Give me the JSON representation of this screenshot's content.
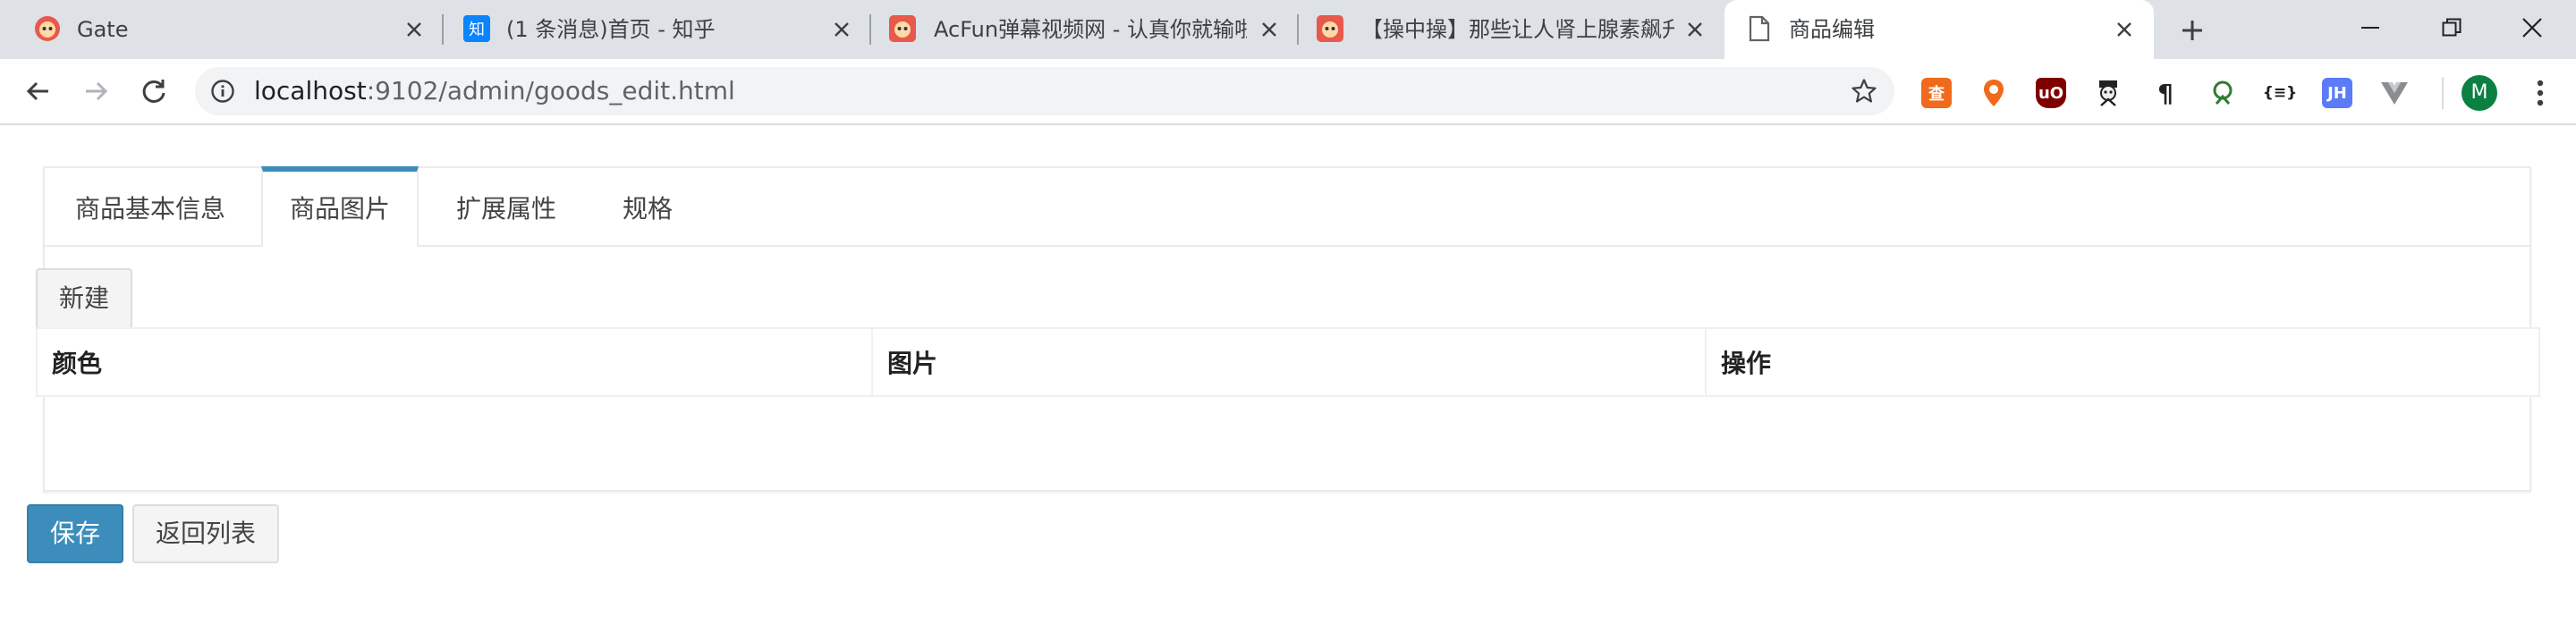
{
  "browser": {
    "tabs": [
      {
        "title": "Gate",
        "active": false
      },
      {
        "title": "(1 条消息)首页 - 知乎",
        "active": false
      },
      {
        "title": "AcFun弹幕视频网 - 认真你就输啦",
        "active": false
      },
      {
        "title": "【操中操】那些让人肾上腺素飙升",
        "active": false
      },
      {
        "title": "商品编辑",
        "active": true
      }
    ],
    "address": {
      "host": "localhost",
      "rest": ":9102/admin/goods_edit.html"
    },
    "extensions": [
      "查",
      "◆",
      "uO",
      "",
      "¶",
      "",
      "{≡}",
      "JH",
      "V"
    ],
    "profile_initial": "M"
  },
  "page": {
    "tabs": [
      {
        "label": "商品基本信息",
        "active": false
      },
      {
        "label": "商品图片",
        "active": true
      },
      {
        "label": "扩展属性",
        "active": false
      },
      {
        "label": "规格",
        "active": false
      }
    ],
    "new_button": "新建",
    "table": {
      "headers": [
        "颜色",
        "图片",
        "操作"
      ],
      "rows": []
    },
    "save_button": "保存",
    "back_button": "返回列表"
  },
  "colors": {
    "primary": "#3c8dbc",
    "tab_active_border": "#3c8dbc",
    "chrome_bg": "#dee1e6"
  }
}
